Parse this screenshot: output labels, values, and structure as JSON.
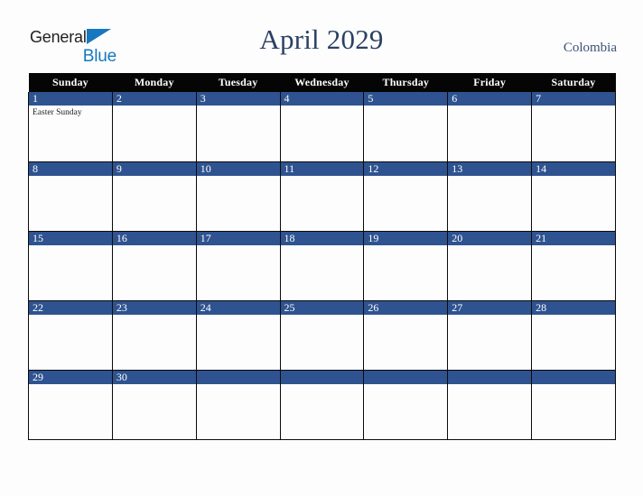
{
  "brand": {
    "word1": "General",
    "word2": "Blue",
    "triangle_icon": "triangle-icon",
    "color_dark": "#231f20",
    "color_blue": "#1878be"
  },
  "header": {
    "title": "April 2029",
    "country": "Colombia",
    "title_color": "#2b4064",
    "country_color": "#3c5078"
  },
  "calendar": {
    "weekday_headers": [
      "Sunday",
      "Monday",
      "Tuesday",
      "Wednesday",
      "Thursday",
      "Friday",
      "Saturday"
    ],
    "header_bg": "#050505",
    "daynum_bg": "#2e5390",
    "cell_bg": "#fdfdfd",
    "border_color": "#0b0b0b",
    "weeks": [
      [
        {
          "day": "1",
          "events": [
            "Easter Sunday"
          ]
        },
        {
          "day": "2",
          "events": []
        },
        {
          "day": "3",
          "events": []
        },
        {
          "day": "4",
          "events": []
        },
        {
          "day": "5",
          "events": []
        },
        {
          "day": "6",
          "events": []
        },
        {
          "day": "7",
          "events": []
        }
      ],
      [
        {
          "day": "8",
          "events": []
        },
        {
          "day": "9",
          "events": []
        },
        {
          "day": "10",
          "events": []
        },
        {
          "day": "11",
          "events": []
        },
        {
          "day": "12",
          "events": []
        },
        {
          "day": "13",
          "events": []
        },
        {
          "day": "14",
          "events": []
        }
      ],
      [
        {
          "day": "15",
          "events": []
        },
        {
          "day": "16",
          "events": []
        },
        {
          "day": "17",
          "events": []
        },
        {
          "day": "18",
          "events": []
        },
        {
          "day": "19",
          "events": []
        },
        {
          "day": "20",
          "events": []
        },
        {
          "day": "21",
          "events": []
        }
      ],
      [
        {
          "day": "22",
          "events": []
        },
        {
          "day": "23",
          "events": []
        },
        {
          "day": "24",
          "events": []
        },
        {
          "day": "25",
          "events": []
        },
        {
          "day": "26",
          "events": []
        },
        {
          "day": "27",
          "events": []
        },
        {
          "day": "28",
          "events": []
        }
      ],
      [
        {
          "day": "29",
          "events": []
        },
        {
          "day": "30",
          "events": []
        },
        {
          "day": "",
          "events": []
        },
        {
          "day": "",
          "events": []
        },
        {
          "day": "",
          "events": []
        },
        {
          "day": "",
          "events": []
        },
        {
          "day": "",
          "events": []
        }
      ]
    ]
  }
}
